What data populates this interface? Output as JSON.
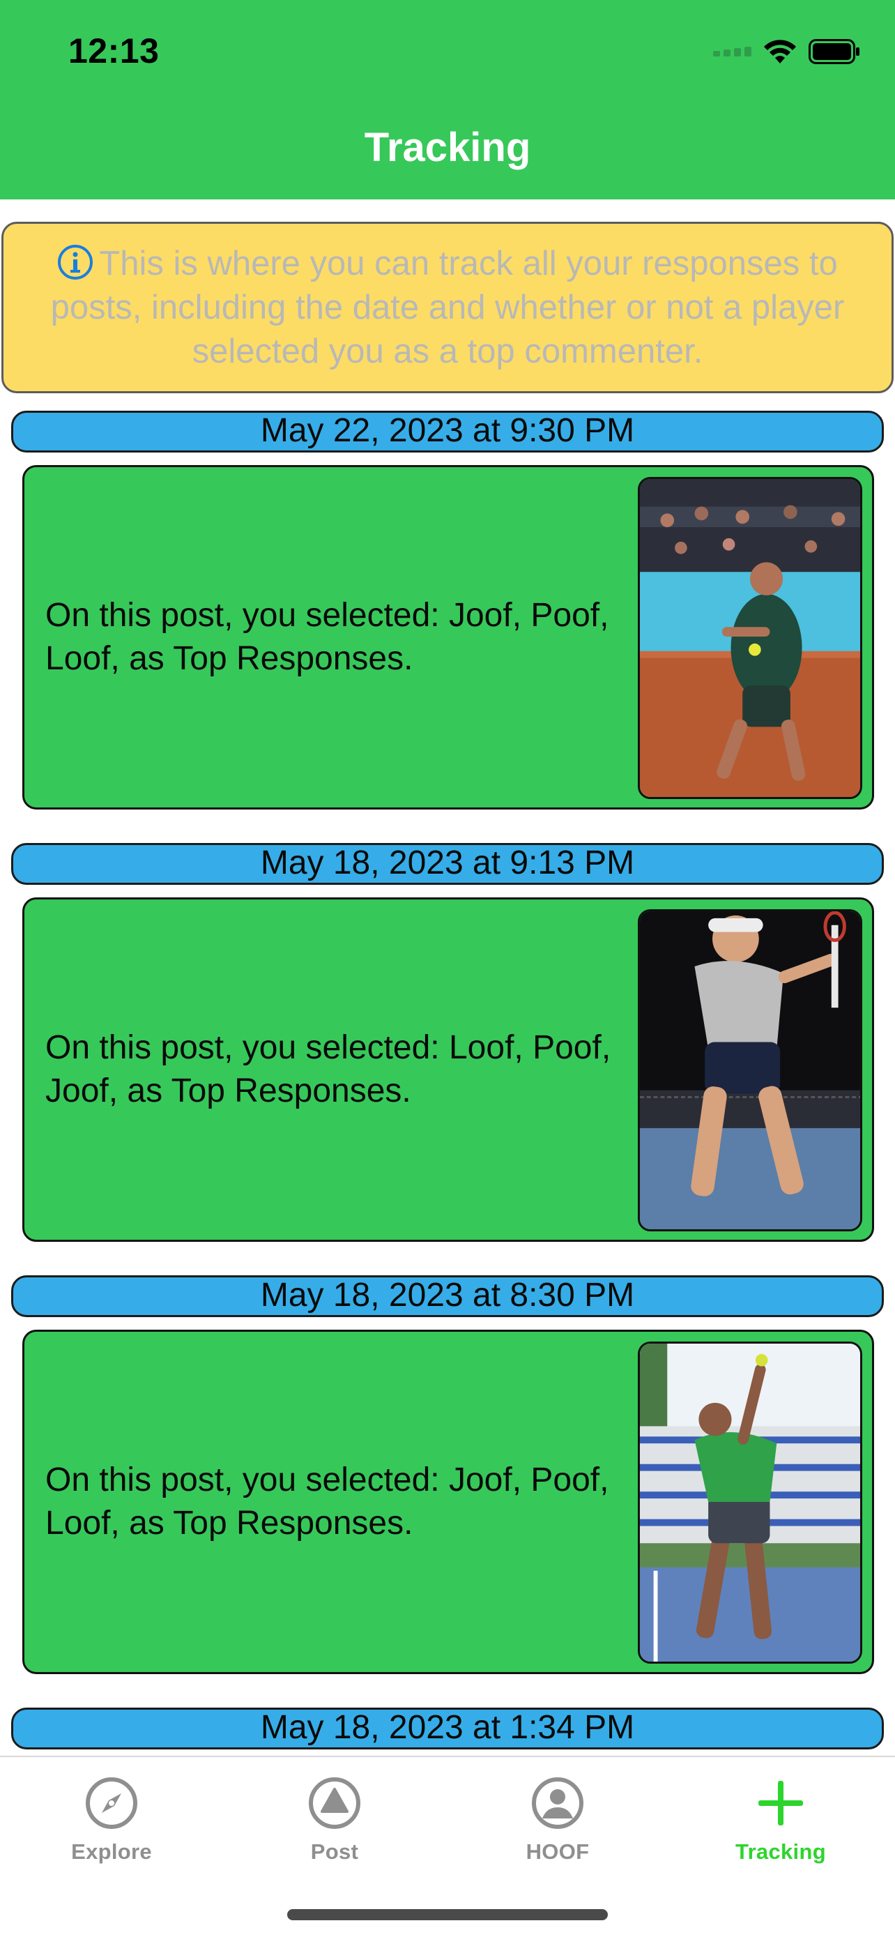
{
  "status_bar": {
    "time": "12:13"
  },
  "header": {
    "title": "Tracking"
  },
  "banner": {
    "icon": "info-circle-icon",
    "text": "This is where you can track all your responses to posts, including the date and whether or not a player selected you as a top commenter."
  },
  "entries": [
    {
      "date": "May 22, 2023 at 9:30 PM",
      "text": "On this post, you selected: Joof, Poof, Loof, as Top Responses.",
      "photo": "tennis-player-clay-court-photo"
    },
    {
      "date": "May 18, 2023 at 9:13 PM",
      "text": "On this post, you selected: Loof, Poof, Joof, as Top Responses.",
      "photo": "tennis-player-backhand-photo"
    },
    {
      "date": "May 18, 2023 at 8:30 PM",
      "text": "On this post, you selected: Joof, Poof, Loof, as Top Responses.",
      "photo": "tennis-player-serve-photo"
    },
    {
      "date": "May 18, 2023 at 1:34 PM"
    }
  ],
  "tabbar": {
    "tabs": [
      {
        "label": "Explore",
        "icon": "compass-icon",
        "active": false
      },
      {
        "label": "Post",
        "icon": "triangle-circle-icon",
        "active": false
      },
      {
        "label": "HOOF",
        "icon": "person-circle-icon",
        "active": false
      },
      {
        "label": "Tracking",
        "icon": "plus-icon",
        "active": true
      }
    ]
  },
  "colors": {
    "header_green": "#37c85a",
    "banner_yellow": "#fcdc64",
    "date_blue": "#36ade8",
    "active_tab_green": "#2cd52c",
    "inactive_tab_gray": "#8f8f8f"
  }
}
